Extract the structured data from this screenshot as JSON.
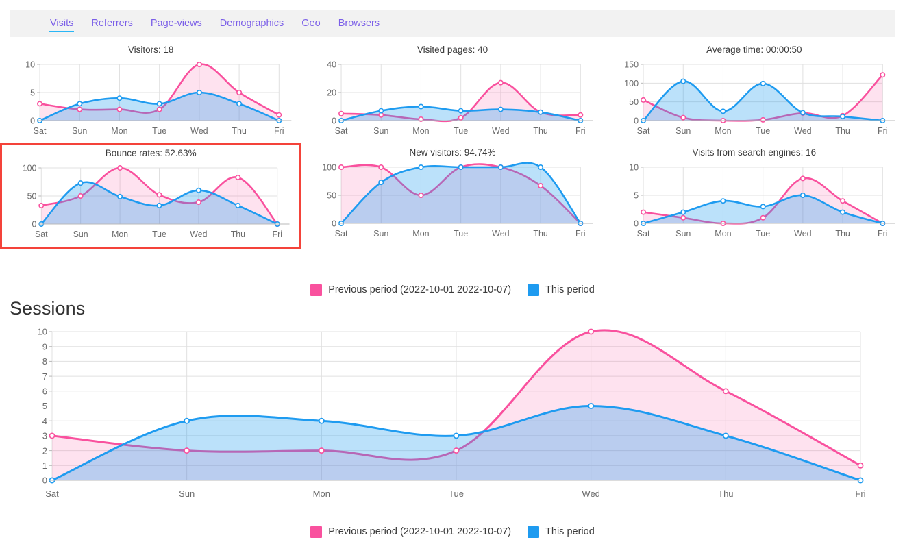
{
  "tabs": [
    {
      "label": "Visits",
      "active": true
    },
    {
      "label": "Referrers",
      "active": false
    },
    {
      "label": "Page-views",
      "active": false
    },
    {
      "label": "Demographics",
      "active": false
    },
    {
      "label": "Geo",
      "active": false
    },
    {
      "label": "Browsers",
      "active": false
    }
  ],
  "colors": {
    "previous_period": "#f9519e",
    "this_period": "#1e9bf0",
    "highlight_border": "#f4433a",
    "tab_text": "#7b5fe8",
    "tab_underline": "#29b6f6",
    "tabbar_background": "#f2f2f2"
  },
  "legend": {
    "previous_label": "Previous period (2022-10-01 2022-10-07)",
    "current_label": "This period"
  },
  "sessions": {
    "heading": "Sessions"
  },
  "chart_data": [
    {
      "type": "area",
      "name": "visitors",
      "title": "Visitors: 18",
      "categories": [
        "Sat",
        "Sun",
        "Mon",
        "Tue",
        "Wed",
        "Thu",
        "Fri"
      ],
      "series": [
        {
          "name": "Previous period (2022-10-01 2022-10-07)",
          "color": "#f9519e",
          "values": [
            3,
            2,
            2,
            2,
            10,
            5,
            1
          ]
        },
        {
          "name": "This period",
          "color": "#1e9bf0",
          "values": [
            0,
            3,
            4,
            3,
            5,
            3,
            0
          ]
        }
      ],
      "ylim": [
        0,
        10
      ],
      "yticks": [
        0,
        5,
        10
      ],
      "xlabel": "",
      "ylabel": "",
      "grid": true,
      "legend_position": "bottom"
    },
    {
      "type": "area",
      "name": "visited-pages",
      "title": "Visited pages: 40",
      "categories": [
        "Sat",
        "Sun",
        "Mon",
        "Tue",
        "Wed",
        "Thu",
        "Fri"
      ],
      "series": [
        {
          "name": "Previous period (2022-10-01 2022-10-07)",
          "color": "#f9519e",
          "values": [
            5,
            4,
            1,
            2,
            27,
            6,
            4
          ]
        },
        {
          "name": "This period",
          "color": "#1e9bf0",
          "values": [
            0,
            7,
            10,
            7,
            8,
            6,
            0
          ]
        }
      ],
      "ylim": [
        0,
        40
      ],
      "yticks": [
        0,
        20,
        40
      ],
      "xlabel": "",
      "ylabel": "",
      "grid": true,
      "legend_position": "bottom"
    },
    {
      "type": "area",
      "name": "average-time",
      "title": "Average time: 00:00:50",
      "categories": [
        "Sat",
        "Sun",
        "Mon",
        "Tue",
        "Wed",
        "Thu",
        "Fri"
      ],
      "series": [
        {
          "name": "Previous period (2022-10-01 2022-10-07)",
          "color": "#f9519e",
          "values": [
            55,
            8,
            0,
            2,
            20,
            13,
            122
          ]
        },
        {
          "name": "This period",
          "color": "#1e9bf0",
          "values": [
            0,
            105,
            25,
            99,
            21,
            11,
            0
          ]
        }
      ],
      "ylim": [
        0,
        150
      ],
      "yticks": [
        0,
        50,
        100,
        150
      ],
      "xlabel": "",
      "ylabel": "",
      "grid": true,
      "legend_position": "bottom"
    },
    {
      "type": "area",
      "name": "bounce-rates",
      "title": "Bounce rates: 52.63%",
      "highlighted": true,
      "categories": [
        "Sat",
        "Sun",
        "Mon",
        "Tue",
        "Wed",
        "Thu",
        "Fri"
      ],
      "series": [
        {
          "name": "Previous period (2022-10-01 2022-10-07)",
          "color": "#f9519e",
          "values": [
            33,
            50,
            100,
            52,
            39,
            83,
            0
          ]
        },
        {
          "name": "This period",
          "color": "#1e9bf0",
          "values": [
            0,
            73,
            49,
            33,
            60,
            33,
            0
          ]
        }
      ],
      "ylim": [
        0,
        100
      ],
      "yticks": [
        0,
        50,
        100
      ],
      "xlabel": "",
      "ylabel": "",
      "grid": true,
      "legend_position": "bottom"
    },
    {
      "type": "area",
      "name": "new-visitors",
      "title": "New visitors: 94.74%",
      "categories": [
        "Sat",
        "Sun",
        "Mon",
        "Tue",
        "Wed",
        "Thu",
        "Fri"
      ],
      "series": [
        {
          "name": "Previous period (2022-10-01 2022-10-07)",
          "color": "#f9519e",
          "values": [
            100,
            100,
            50,
            100,
            100,
            67,
            0
          ]
        },
        {
          "name": "This period",
          "color": "#1e9bf0",
          "values": [
            0,
            73,
            100,
            100,
            100,
            100,
            0
          ]
        }
      ],
      "ylim": [
        0,
        100
      ],
      "yticks": [
        0,
        50,
        100
      ],
      "xlabel": "",
      "ylabel": "",
      "grid": true,
      "legend_position": "bottom"
    },
    {
      "type": "area",
      "name": "visits-from-search-engines",
      "title": "Visits from search engines: 16",
      "categories": [
        "Sat",
        "Sun",
        "Mon",
        "Tue",
        "Wed",
        "Thu",
        "Fri"
      ],
      "series": [
        {
          "name": "Previous period (2022-10-01 2022-10-07)",
          "color": "#f9519e",
          "values": [
            2,
            1,
            0,
            1,
            8,
            4,
            0
          ]
        },
        {
          "name": "This period",
          "color": "#1e9bf0",
          "values": [
            0,
            2,
            4,
            3,
            5,
            2,
            0
          ]
        }
      ],
      "ylim": [
        0,
        10
      ],
      "yticks": [
        0,
        5,
        10
      ],
      "xlabel": "",
      "ylabel": "",
      "grid": true,
      "legend_position": "bottom"
    },
    {
      "type": "area",
      "name": "sessions",
      "title": "Sessions",
      "categories": [
        "Sat",
        "Sun",
        "Mon",
        "Tue",
        "Wed",
        "Thu",
        "Fri"
      ],
      "series": [
        {
          "name": "Previous period (2022-10-01 2022-10-07)",
          "color": "#f9519e",
          "values": [
            3,
            2,
            2,
            2,
            10,
            6,
            1
          ]
        },
        {
          "name": "This period",
          "color": "#1e9bf0",
          "values": [
            0,
            4,
            4,
            3,
            5,
            3,
            0
          ]
        }
      ],
      "ylim": [
        0,
        10
      ],
      "yticks": [
        0,
        1,
        2,
        3,
        4,
        5,
        6,
        7,
        8,
        9,
        10
      ],
      "xlabel": "",
      "ylabel": "",
      "grid": true,
      "legend_position": "bottom"
    }
  ]
}
